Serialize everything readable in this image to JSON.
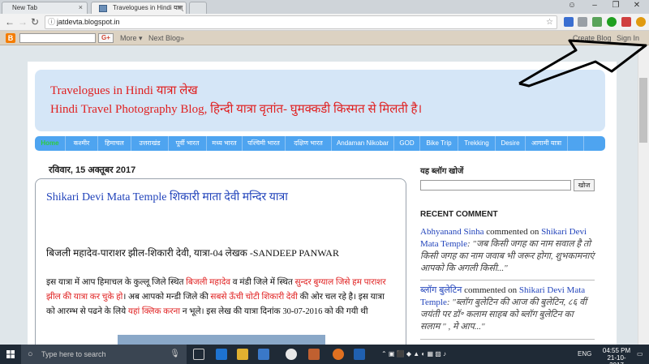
{
  "browser": {
    "tabs": [
      {
        "label": "New Tab"
      },
      {
        "label": "Travelogues in Hindi यात्"
      },
      {
        "label": ""
      }
    ],
    "url": "jatdevta.blogspot.in"
  },
  "blogger_bar": {
    "more": "More ▾",
    "next": "Next Blog»",
    "create": "Create Blog",
    "signin": "Sign In"
  },
  "blog": {
    "title": "Travelogues in Hindi यात्रा लेख",
    "subtitle": "Hindi Travel Photography Blog, हिन्दी यात्रा वृतांत- घुमक्कडी किस्मत से मिलती है।",
    "menu": [
      "Home",
      "कश्मीर",
      "हिमाचल",
      "उत्तराखंड",
      "पूर्वी भारत",
      "मध्य भारत",
      "पश्चिमी भारत",
      "दक्षिण भारत",
      "Andaman Nikobar",
      "GOD",
      "Bike Trip",
      "Trekking",
      "Desire",
      "आगामी यात्रा"
    ]
  },
  "post": {
    "date": "रविवार, 15 अक्तूबर 2017",
    "title": "Shikari Devi Mata Temple शिकारी माता देवी मन्दिर यात्रा",
    "line1": "बिजली महादेव-पाराशर झील-शिकारी देवी, यात्रा-04   लेखक -SANDEEP PANWAR",
    "para": {
      "t1": "इस यात्रा में आप हिमाचल के कुल्लू जिले स्थित ",
      "r1": "बिजली महादेव",
      "t2": " व मंडी जिले में स्थित ",
      "r2": "सुन्दर बुग्याल जिसे हम पाराशर झील की यात्रा कर चुके हो",
      "t3": "। अब आपको मन्डी जिले की ",
      "r3": "सबसे ऊँची चोटी शिकारी देवी",
      "t4": " की ओर चल रहे है। इस यात्रा को आरम्भ से पढने के लिये ",
      "r4": "यहां क्लिक करना",
      "t5": " न भूले। इस लेख की यात्रा दिनांक 30-07-2016 को की गयी थी"
    }
  },
  "sidebar": {
    "search_heading": "यह ब्लॉग खोजें",
    "search_button": "खोज",
    "recent_heading": "RECENT COMMENT",
    "comments": [
      {
        "author": "Abhyanand Sinha",
        "mid": " commented on ",
        "target": "Shikari Devi Mata Temple",
        "text": ": \"जब किसी जगह का नाम सवाल है तो किसी जगह का नाम जवाब भी जरूर होगा, शुभकामनाएं आपको कि अगली किसी...\""
      },
      {
        "author": "ब्लॉग बुलेटिन",
        "mid": " commented on ",
        "target": "Shikari Devi Mata Temple",
        "text": ": \"ब्लॉग बुलेटिन की आज की बुलेटिन, ८६ वीं जयंती पर डॉ॰ कलाम साहब को ब्लॉग बुलेटिन का सलाम \" , मे आप...\""
      }
    ]
  },
  "taskbar": {
    "search_placeholder": "Type here to search",
    "lang": "ENG",
    "time": "04:55 PM",
    "date": "21-10-2017"
  }
}
